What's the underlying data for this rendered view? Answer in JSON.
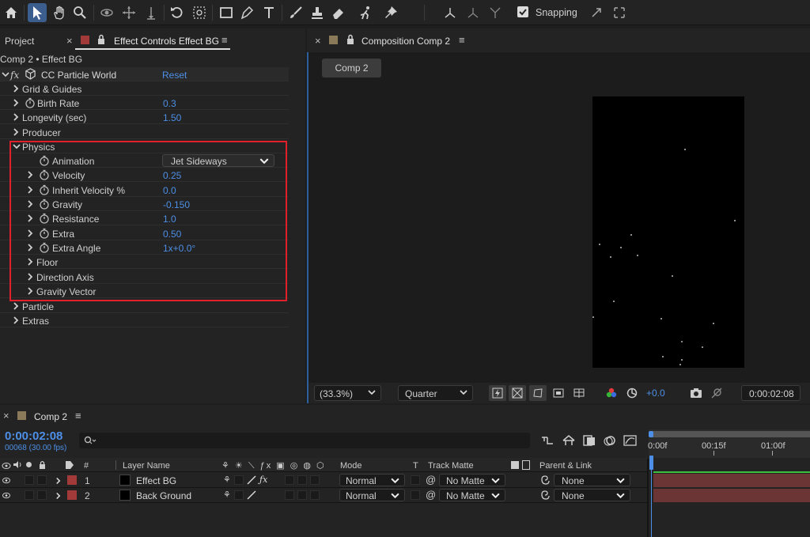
{
  "toolbar": {
    "tools": [
      "home-icon",
      "selection-icon",
      "hand-icon",
      "zoom-icon",
      "orbit-icon",
      "pan-icon",
      "dolly-icon",
      "rotate-icon",
      "anchor-icon",
      "rectangle-icon",
      "pen-icon",
      "type-icon",
      "brush-icon",
      "clone-stamp-icon",
      "eraser-icon",
      "roto-brush-icon",
      "puppet-pin-icon"
    ],
    "snapping_label": "Snapping",
    "snapping_checked": true
  },
  "left_panel": {
    "tab_project": "Project",
    "tab_effect_controls": "Effect Controls Effect BG",
    "breadcrumb": "Comp 2 • Effect BG",
    "effect_name": "CC Particle World",
    "reset_label": "Reset",
    "fx_label": "fx"
  },
  "properties": [
    {
      "label": "Grid & Guides",
      "value": ""
    },
    {
      "label": "Birth Rate",
      "value": "0.3"
    },
    {
      "label": "Longevity (sec)",
      "value": "1.50"
    },
    {
      "label": "Producer",
      "value": ""
    },
    {
      "label": "Physics",
      "value": ""
    },
    {
      "label": "Animation",
      "value": "Jet Sideways"
    },
    {
      "label": "Velocity",
      "value": "0.25"
    },
    {
      "label": "Inherit Velocity %",
      "value": "0.0"
    },
    {
      "label": "Gravity",
      "value": "-0.150"
    },
    {
      "label": "Resistance",
      "value": "1.0"
    },
    {
      "label": "Extra",
      "value": "0.50"
    },
    {
      "label": "Extra Angle",
      "value": "1x+0.0°"
    },
    {
      "label": "Floor",
      "value": ""
    },
    {
      "label": "Direction Axis",
      "value": ""
    },
    {
      "label": "Gravity Vector",
      "value": ""
    },
    {
      "label": "Particle",
      "value": ""
    },
    {
      "label": "Extras",
      "value": ""
    }
  ],
  "comp_panel": {
    "tab_label": "Composition Comp 2",
    "comp_button": "Comp 2",
    "zoom": "(33.3%)",
    "resolution": "Quarter",
    "exposure": "+0.0",
    "timecode": "0:00:02:08"
  },
  "timeline": {
    "tab_label": "Comp 2",
    "timecode": "0:00:02:08",
    "frame_info": "00068 (30.00 fps)",
    "search_placeholder": "",
    "col_number": "#",
    "col_layer_name": "Layer Name",
    "col_mode": "Mode",
    "col_t": "T",
    "col_track_matte": "Track Matte",
    "col_parent": "Parent & Link",
    "ruler": [
      "0:00f",
      "00:15f",
      "01:00f"
    ],
    "layers": [
      {
        "num": "1",
        "name": "Effect BG",
        "mode": "Normal",
        "matte": "No Matte",
        "parent": "None"
      },
      {
        "num": "2",
        "name": "Back Ground",
        "mode": "Normal",
        "matte": "No Matte",
        "parent": "None"
      }
    ]
  },
  "colors": {
    "accent": "#4d8fe6",
    "highlight_box": "#e0212a",
    "layer_label": "#a23a3a",
    "track_bar": "#6b3535"
  }
}
